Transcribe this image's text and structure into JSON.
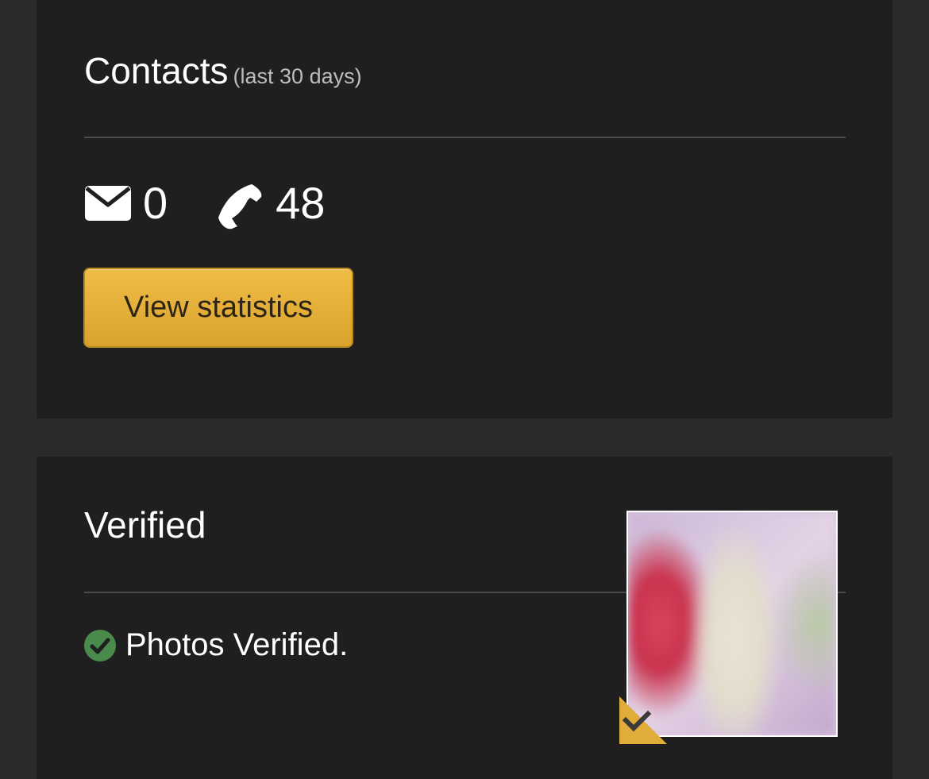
{
  "contacts": {
    "title": "Contacts",
    "subtitle": "(last 30 days)",
    "messages_count": "0",
    "calls_count": "48",
    "view_statistics_label": "View statistics",
    "icons": {
      "messages": "envelope-icon",
      "calls": "phone-icon"
    }
  },
  "verified": {
    "title": "Verified",
    "status_text": "Photos Verified.",
    "status_icon": "check-circle-icon",
    "badge_icon": "verified-check-badge-icon"
  },
  "colors": {
    "page_background": "#2a2a2a",
    "panel_background": "#1f1f1f",
    "button_gold": "#e8b13d",
    "check_green": "#4a8a4a",
    "badge_gold": "#e0ad3a"
  }
}
